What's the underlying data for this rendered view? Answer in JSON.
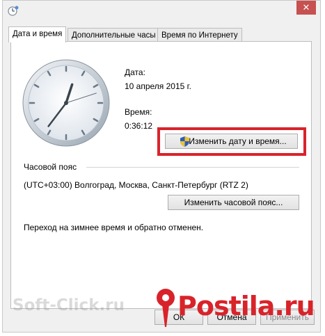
{
  "window": {
    "close_glyph": "✕"
  },
  "tabs": [
    {
      "label": "Дата и время",
      "active": true
    },
    {
      "label": "Дополнительные часы",
      "active": false
    },
    {
      "label": "Время по Интернету",
      "active": false
    }
  ],
  "date_section": {
    "label": "Дата:",
    "value": "10 апреля 2015 г."
  },
  "time_section": {
    "label": "Время:",
    "value": "0:36:12"
  },
  "buttons": {
    "change_datetime": "Изменить дату и время...",
    "change_timezone": "Изменить часовой пояс...",
    "ok": "ОК",
    "cancel": "Отмена",
    "apply": "Применить"
  },
  "timezone": {
    "heading": "Часовой пояс",
    "value": "(UTC+03:00) Волгоград, Москва, Санкт-Петербург (RTZ 2)"
  },
  "dst_note": "Переход на зимнее время и обратно отменен.",
  "clock": {
    "hours": 0,
    "minutes": 36,
    "seconds": 12
  },
  "watermarks": {
    "soft_click": "Soft-Click.ru",
    "postila": "Postila.ru"
  },
  "colors": {
    "highlight": "#d9232a",
    "close_button": "#c75050",
    "shield_blue": "#2a5fb8",
    "shield_yellow": "#f2c12e"
  },
  "icons": [
    "clock-icon",
    "shield-icon",
    "close-icon",
    "pin-icon"
  ]
}
